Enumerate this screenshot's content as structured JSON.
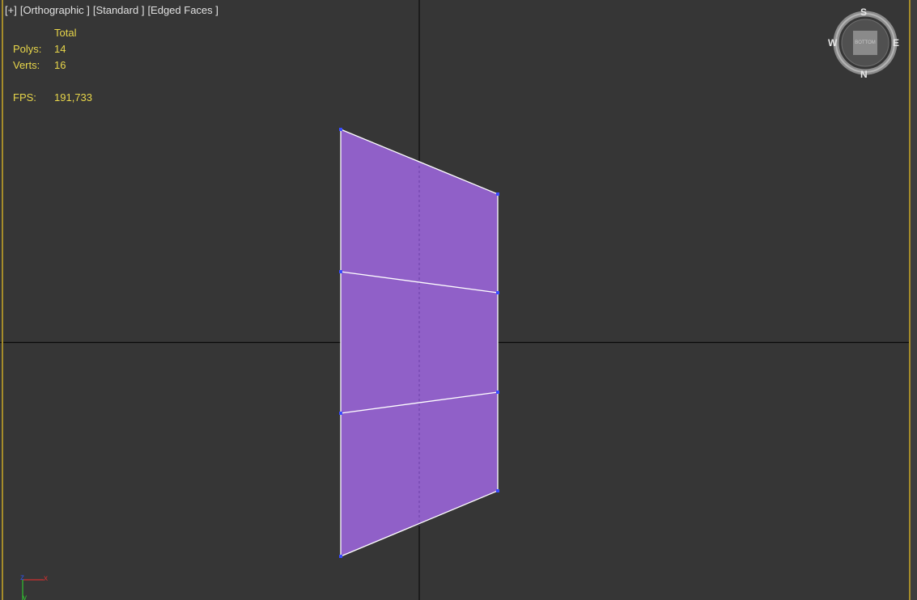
{
  "viewport": {
    "labels": [
      "[+]",
      "[Orthographic ]",
      "[Standard ]",
      "[Edged Faces ]"
    ],
    "colors": {
      "background": "#363636",
      "border": "#a58c2a",
      "mesh_fill": "#9060c8",
      "edge": "#ffffff",
      "vertex": "#3a4cff",
      "stats_text": "#e8d64a"
    }
  },
  "stats": {
    "header": "Total",
    "polys_label": "Polys:",
    "polys_value": "14",
    "verts_label": "Verts:",
    "verts_value": "16",
    "fps_label": "FPS:",
    "fps_value": "191,733"
  },
  "viewcube": {
    "north": "N",
    "south": "S",
    "east": "E",
    "west": "W",
    "face_label": "BOTTOM"
  },
  "axis_gizmo": {
    "axes": [
      "z",
      "x",
      "y"
    ]
  }
}
